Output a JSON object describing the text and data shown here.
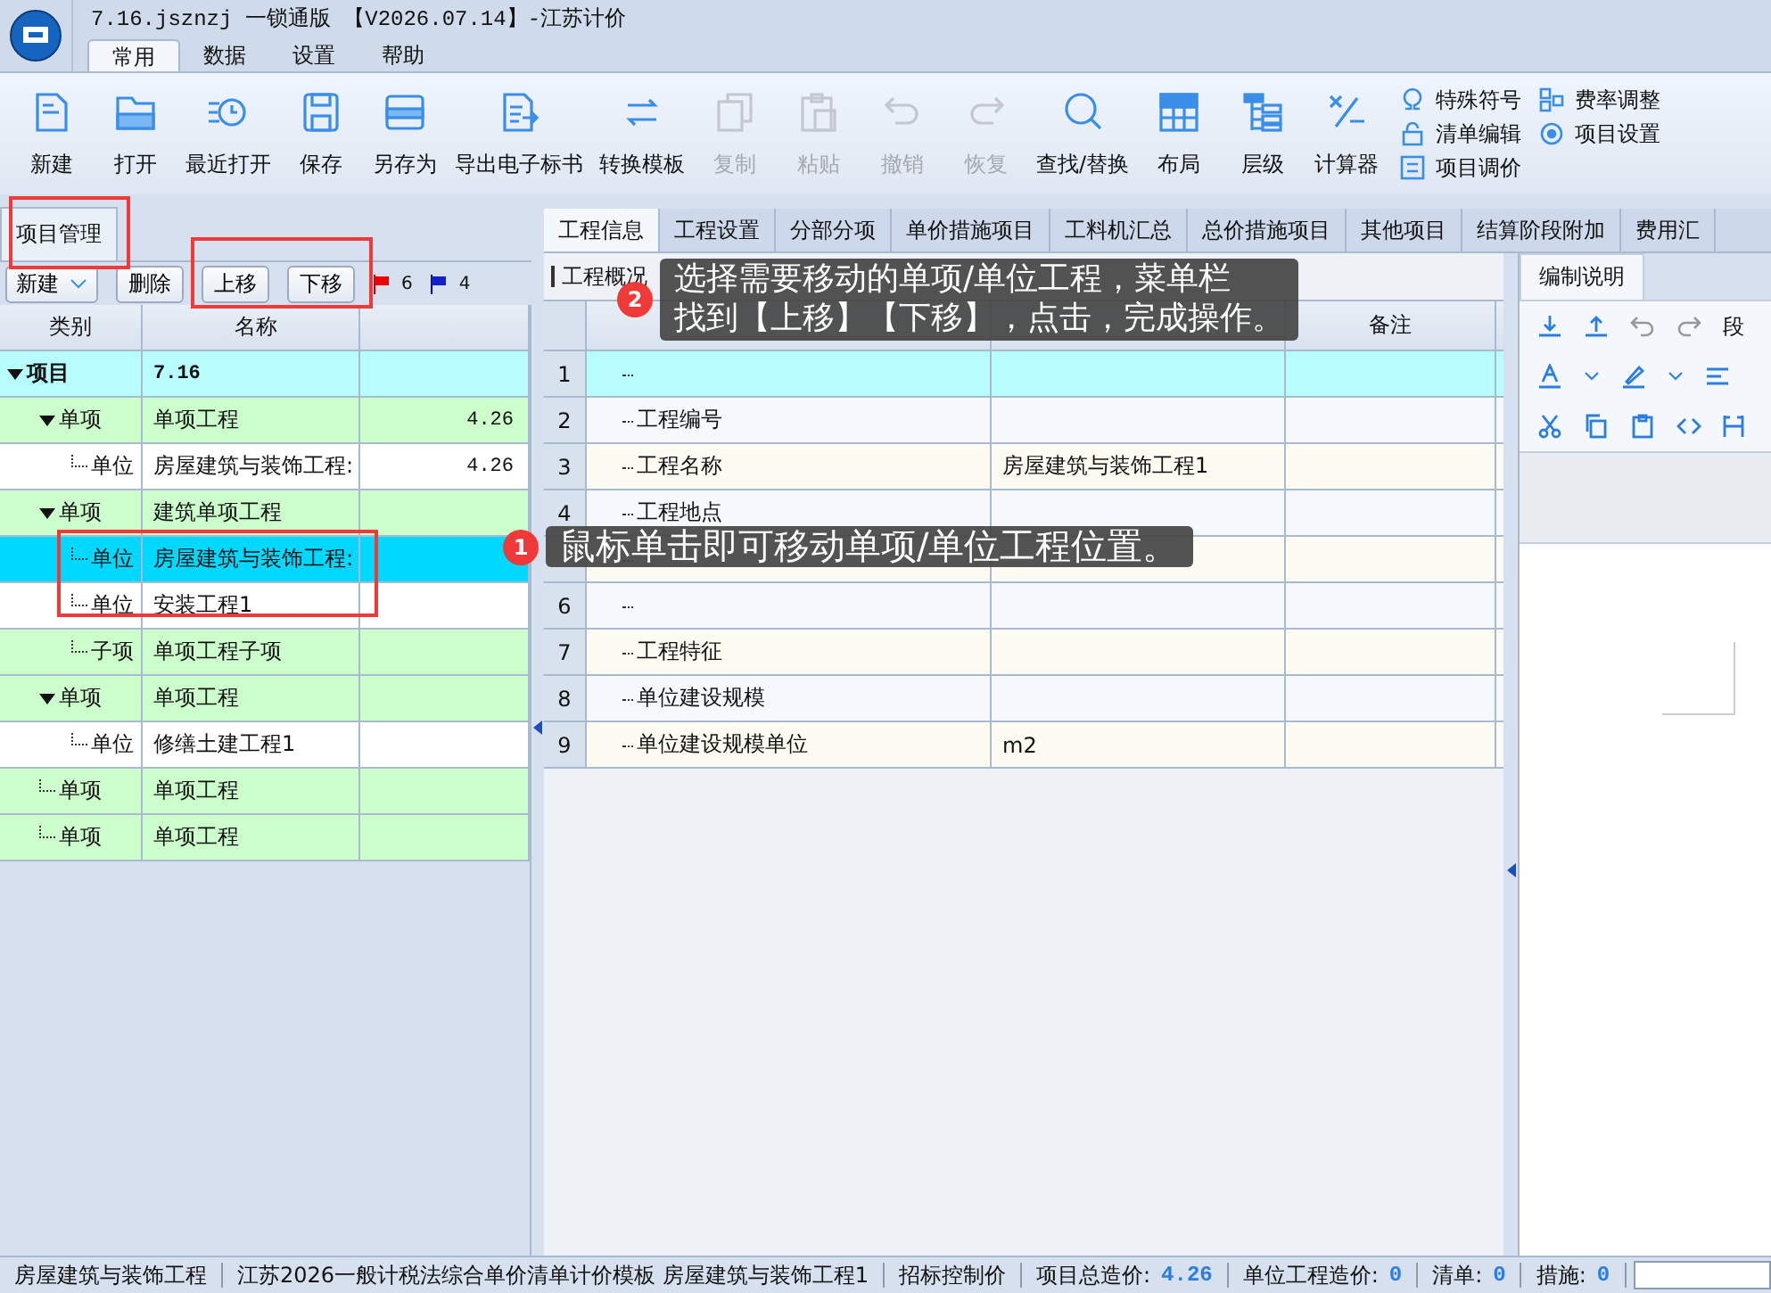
{
  "app": {
    "title": "7.16.jsznzj 一锁通版 【V2026.07.14】-江苏计价"
  },
  "ribbon_tabs": [
    {
      "label": "常用",
      "selected": true
    },
    {
      "label": "数据",
      "selected": false
    },
    {
      "label": "设置",
      "selected": false
    },
    {
      "label": "帮助",
      "selected": false
    }
  ],
  "toolbar": [
    {
      "label": "新建",
      "disabled": false
    },
    {
      "label": "打开",
      "disabled": false
    },
    {
      "label": "最近打开",
      "disabled": false
    },
    {
      "label": "保存",
      "disabled": false
    },
    {
      "label": "另存为",
      "disabled": false
    },
    {
      "label": "导出电子标书",
      "disabled": false
    },
    {
      "label": "转换模板",
      "disabled": false
    },
    {
      "label": "复制",
      "disabled": true
    },
    {
      "label": "粘贴",
      "disabled": true
    },
    {
      "label": "撤销",
      "disabled": true
    },
    {
      "label": "恢复",
      "disabled": true
    },
    {
      "label": "查找/替换",
      "disabled": false
    },
    {
      "label": "布局",
      "disabled": false
    },
    {
      "label": "层级",
      "disabled": false
    },
    {
      "label": "计算器",
      "disabled": false
    }
  ],
  "toolbar_small": [
    {
      "label": "特殊符号"
    },
    {
      "label": "清单编辑"
    },
    {
      "label": "项目调价"
    },
    {
      "label": "费率调整"
    },
    {
      "label": "项目设置"
    }
  ],
  "left_panel": {
    "tab": "项目管理",
    "buttons": [
      "新建",
      "删除",
      "上移",
      "下移"
    ],
    "red_flag_count": "6",
    "blue_flag_count": "4",
    "columns": [
      "类别",
      "名称"
    ],
    "tree": [
      {
        "type": "项目",
        "name": "7.16",
        "kind": "project",
        "selected": false,
        "expanded": true,
        "children": [
          {
            "type": "单项",
            "name": "单项工程",
            "total": "4.26",
            "kind": "item",
            "selected": false,
            "expanded": true,
            "children": [
              {
                "type": "单位",
                "name": "房屋建筑与装饰工程:",
                "total": "4.26",
                "kind": "unit",
                "selected": false
              }
            ]
          },
          {
            "type": "单项",
            "name": "建筑单项工程",
            "kind": "item",
            "selected": false,
            "expanded": true,
            "children": [
              {
                "type": "单位",
                "name": "房屋建筑与装饰工程:",
                "kind": "unit",
                "selected": true
              },
              {
                "type": "单位",
                "name": "安装工程1",
                "kind": "unit",
                "selected": false
              },
              {
                "type": "子项",
                "name": "单项工程子项",
                "kind": "item",
                "selected": false
              }
            ]
          },
          {
            "type": "单项",
            "name": "单项工程",
            "kind": "item",
            "selected": false,
            "expanded": true,
            "children": [
              {
                "type": "单位",
                "name": "修缮土建工程1",
                "kind": "unit",
                "selected": false
              }
            ]
          },
          {
            "type": "单项",
            "name": "单项工程",
            "kind": "item",
            "selected": false
          },
          {
            "type": "单项",
            "name": "单项工程",
            "kind": "item",
            "selected": false
          }
        ]
      }
    ]
  },
  "main_tabs": [
    {
      "label": "工程信息",
      "selected": true
    },
    {
      "label": "工程设置",
      "selected": false
    },
    {
      "label": "分部分项",
      "selected": false
    },
    {
      "label": "单价措施项目",
      "selected": false
    },
    {
      "label": "工料机汇总",
      "selected": false
    },
    {
      "label": "总价措施项目",
      "selected": false
    },
    {
      "label": "其他项目",
      "selected": false
    },
    {
      "label": "结算阶段附加",
      "selected": false
    },
    {
      "label": "费用汇",
      "selected": false
    }
  ],
  "info": {
    "section": "工程概况",
    "notes_header": "备注",
    "rows": [
      {
        "no": "1",
        "selected": true
      },
      {
        "no": "2",
        "name": "工程编号",
        "selected": false
      },
      {
        "no": "3",
        "name": "工程名称",
        "content": "房屋建筑与装饰工程1",
        "selected": false
      },
      {
        "no": "4",
        "name": "工程地点",
        "selected": false
      },
      {
        "selected": false
      },
      {
        "no": "6",
        "selected": false
      },
      {
        "no": "7",
        "name": "工程特征",
        "selected": false
      },
      {
        "no": "8",
        "name": "单位建设规模",
        "selected": false
      },
      {
        "no": "9",
        "name": "单位建设规模单位",
        "content": "m2",
        "selected": false
      }
    ]
  },
  "side_panel": {
    "tab": "编制说明",
    "paragraph_label": "段"
  },
  "callouts": [
    {
      "badge": "2",
      "lines": [
        "选择需要移动的单项/单位工程，菜单栏",
        "找到【上移】【下移】，点击，完成操作。"
      ]
    },
    {
      "badge": "1",
      "lines": [
        "鼠标单击即可移动单项/单位工程位置。"
      ]
    }
  ],
  "status_bar": [
    {
      "text": "房屋建筑与装饰工程"
    },
    {
      "text": "江苏2026一般计税法综合单价清单计价模板 房屋建筑与装饰工程1"
    },
    {
      "text": "招标控制价"
    },
    {
      "text": "项目总造价:",
      "value": "4.26"
    },
    {
      "text": "单位工程造价:",
      "value": "0"
    },
    {
      "text": "清单:",
      "value": "0"
    },
    {
      "text": "措施:",
      "value": "0"
    }
  ]
}
